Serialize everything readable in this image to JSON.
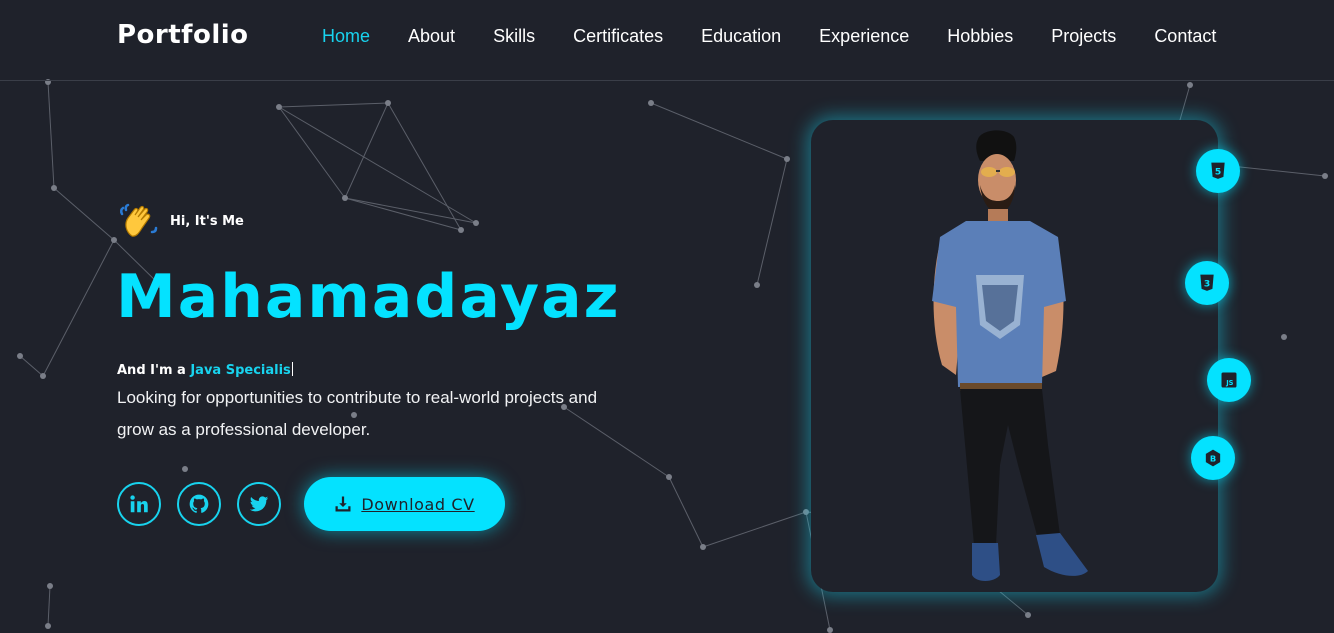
{
  "header": {
    "logo": "Portfolio",
    "nav": [
      {
        "label": "Home",
        "active": true
      },
      {
        "label": "About",
        "active": false
      },
      {
        "label": "Skills",
        "active": false
      },
      {
        "label": "Certificates",
        "active": false
      },
      {
        "label": "Education",
        "active": false
      },
      {
        "label": "Experience",
        "active": false
      },
      {
        "label": "Hobbies",
        "active": false
      },
      {
        "label": "Projects",
        "active": false
      },
      {
        "label": "Contact",
        "active": false
      }
    ]
  },
  "hero": {
    "greeting_icon": "waving-hand-icon",
    "greeting": "Hi, It's Me",
    "name": "Mahamadayaz",
    "role_prefix": "And I'm a ",
    "role_typed": "Java Specialis",
    "description": "Looking for opportunities to contribute to real-world projects and grow as a professional developer.",
    "socials": [
      {
        "name": "linkedin-icon"
      },
      {
        "name": "github-icon"
      },
      {
        "name": "twitter-icon"
      }
    ],
    "cv_button": "Download CV",
    "cv_icon": "download-icon"
  },
  "profile": {
    "photo": "profile-photo",
    "badges": [
      {
        "name": "html5-icon",
        "text": "5"
      },
      {
        "name": "css3-icon",
        "text": "3"
      },
      {
        "name": "javascript-icon",
        "text": "JS"
      },
      {
        "name": "bootstrap-icon",
        "text": "B"
      }
    ]
  },
  "colors": {
    "background": "#1f222b",
    "accent": "#04e2ff",
    "accent_text": "#18d3ee",
    "text": "#ffffff"
  }
}
